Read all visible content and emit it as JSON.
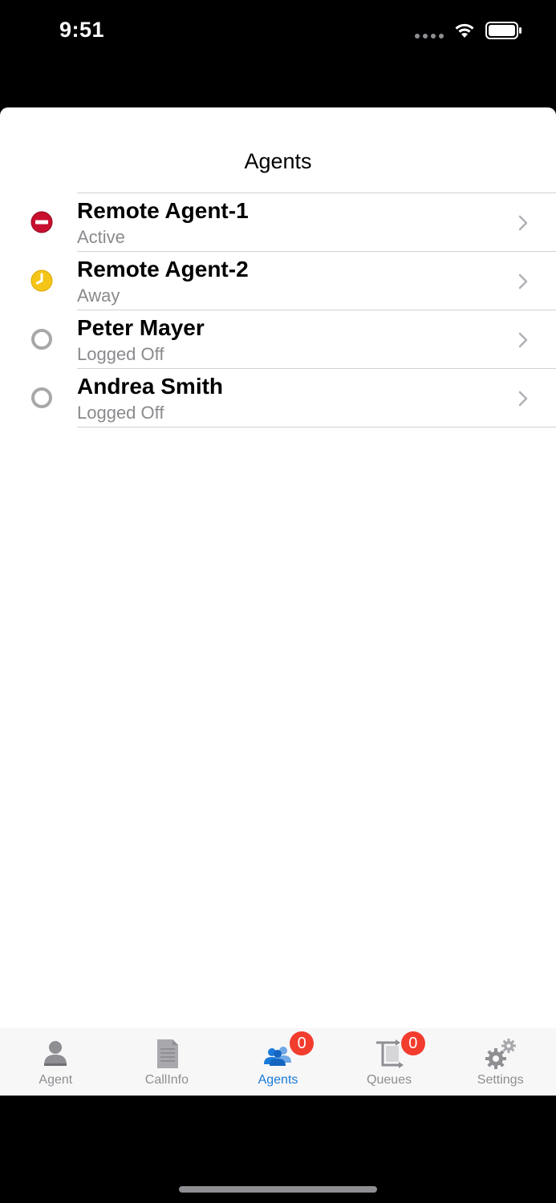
{
  "status_bar": {
    "time": "9:51",
    "icons": [
      "signal-icon",
      "wifi-icon",
      "battery-icon"
    ]
  },
  "header": {
    "title": "Agents"
  },
  "agents": [
    {
      "name": "Remote Agent-1",
      "status": "Active",
      "status_icon": "do-not-disturb-icon",
      "color": "#c8102e"
    },
    {
      "name": "Remote Agent-2",
      "status": "Away",
      "status_icon": "clock-icon",
      "color": "#f5c518"
    },
    {
      "name": "Peter Mayer",
      "status": "Logged Off",
      "status_icon": "offline-ring-icon",
      "color": "#a8a8a8"
    },
    {
      "name": "Andrea Smith",
      "status": "Logged Off",
      "status_icon": "offline-ring-icon",
      "color": "#a8a8a8"
    }
  ],
  "tab_bar": {
    "tabs": [
      {
        "label": "Agent",
        "icon": "person-icon",
        "active": false
      },
      {
        "label": "CallInfo",
        "icon": "document-icon",
        "active": false
      },
      {
        "label": "Agents",
        "icon": "people-icon",
        "active": true,
        "badge": "0"
      },
      {
        "label": "Queues",
        "icon": "queue-transfer-icon",
        "active": false,
        "badge": "0"
      },
      {
        "label": "Settings",
        "icon": "gears-icon",
        "active": false
      }
    ]
  },
  "colors": {
    "accent": "#1a7ad9",
    "badge": "#f23c2e",
    "secondary_text": "#8a8a8e"
  }
}
